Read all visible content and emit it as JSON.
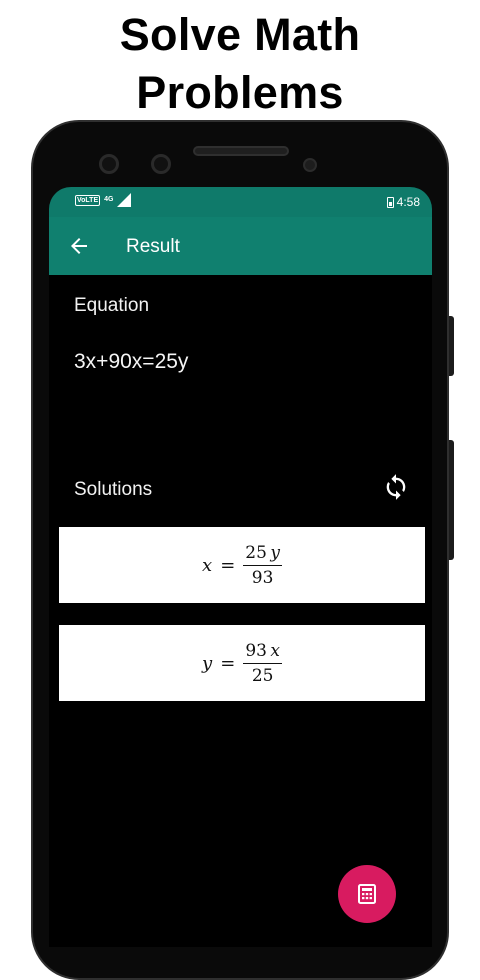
{
  "headline": {
    "line1": "Solve Math",
    "line2": "Problems"
  },
  "status_bar": {
    "volte": "VoLTE",
    "network": "4G",
    "time": "4:58"
  },
  "toolbar": {
    "title": "Result",
    "back_icon": "arrow-back-icon"
  },
  "equation": {
    "label": "Equation",
    "text": "3x+90x=25y"
  },
  "solutions": {
    "label": "Solutions",
    "refresh_icon": "refresh-icon",
    "items": [
      {
        "var": "x",
        "eq": "=",
        "num_coef": "25",
        "num_var": "y",
        "den": "93"
      },
      {
        "var": "y",
        "eq": "=",
        "num_coef": "93",
        "num_var": "x",
        "den": "25"
      }
    ]
  },
  "fab": {
    "icon": "calculator-icon",
    "color": "#d81b60"
  },
  "colors": {
    "toolbar": "#10806f",
    "status_bar": "#0f7a6a",
    "background": "#000000"
  }
}
